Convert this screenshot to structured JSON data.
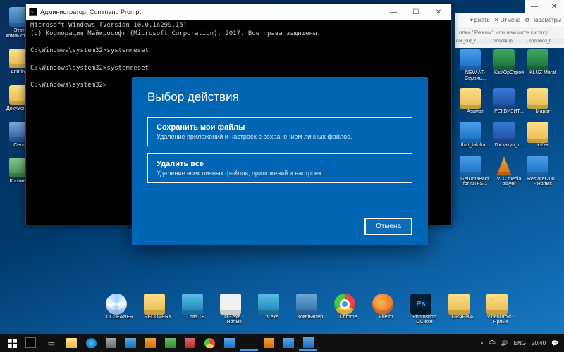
{
  "desktop_left": [
    {
      "label": "Этот\nкомпьюте...",
      "ico": "pc"
    },
    {
      "label": "Admi64",
      "ico": "folder"
    },
    {
      "label": "Документы",
      "ico": "folder"
    },
    {
      "label": "Сеть",
      "ico": "net"
    },
    {
      "label": "Корзина",
      "ico": "recycle"
    }
  ],
  "cmd": {
    "title": "Администратор: Command Prompt",
    "lines": "Microsoft Windows [Version 10.0.16299.15]\n(c) Корпорация Майкрософт (Microsoft Corporation), 2017. Все права защищены.\n\nC:\\Windows\\system32>systemreset\n\nC:\\Windows\\system32>systemreset\n\nC:\\Windows\\system32>"
  },
  "dialog": {
    "title": "Выбор действия",
    "opt1_title": "Сохранить мои файлы",
    "opt1_desc": "Удаление приложений и настроек с сохранением личных файлов.",
    "opt2_title": "Удалить все",
    "opt2_desc": "Удаление всех личных файлов, приложений и настроек.",
    "cancel": "Отмена"
  },
  "rightwin": {
    "keep": "ржать",
    "undo": "Отмена",
    "settings": "Параметры",
    "msg": "опки \"Режим\" или нажмите кнопку",
    "tabs": [
      "doc_sup_r...",
      "GosZakup",
      "soprovod_t..."
    ]
  },
  "desktop_right": [
    {
      "label": "NEW AT-Сервис...",
      "ico": "blue"
    },
    {
      "label": "КазЮрСтрой",
      "ico": "excel"
    },
    {
      "label": "KLUZ Marat",
      "ico": "excel"
    },
    {
      "label": "Азамат",
      "ico": "folder"
    },
    {
      "label": "РЕКВИЗИТ...",
      "ico": "word"
    },
    {
      "label": "Марат",
      "ico": "folder"
    },
    {
      "label": "that_tak-ka...",
      "ico": "blue"
    },
    {
      "label": "Госзакуп_т...",
      "ico": "word"
    },
    {
      "label": "Узбек",
      "ico": "folder"
    },
    {
      "label": "GetDataBack for NTFS...",
      "ico": "blue"
    },
    {
      "label": "VLC media player",
      "ico": "vlc"
    },
    {
      "label": "Restorer200... - Ярлык",
      "ico": "blue"
    }
  ],
  "desktop_bottom": [
    {
      "label": "CCLEANER",
      "ico": "disc"
    },
    {
      "label": "RECOVERY",
      "ico": "folder"
    },
    {
      "label": "Глаз.ТВ",
      "ico": "tv"
    },
    {
      "label": "cr3.exe - Ярлык",
      "ico": "white"
    },
    {
      "label": "tv.exe",
      "ico": "tv"
    },
    {
      "label": "Компьютер",
      "ico": "pc"
    },
    {
      "label": "Chrome",
      "ico": "chrome"
    },
    {
      "label": "Firefox",
      "ico": "firefox"
    },
    {
      "label": "Photoshop CC.exe",
      "ico": "ps",
      "text": "Ps"
    },
    {
      "label": "GRAFIKA",
      "ico": "folder"
    },
    {
      "label": "VideoUroki - Ярлык",
      "ico": "folder"
    }
  ],
  "tray": {
    "lang": "ENG",
    "time": "20:40"
  }
}
